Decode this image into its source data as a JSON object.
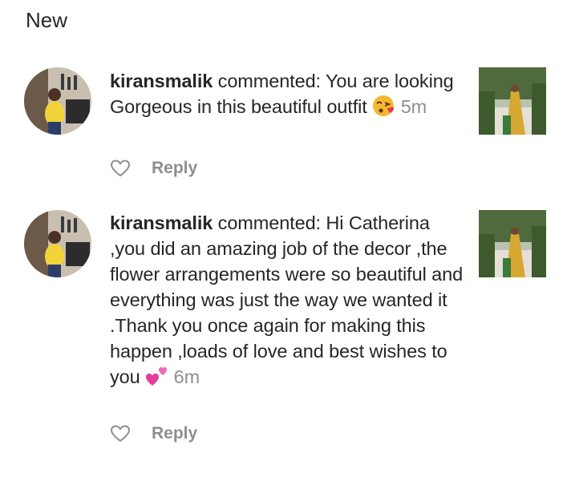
{
  "section": {
    "title": "New"
  },
  "notifications": [
    {
      "username": "kiransmalik",
      "action": " commented: ",
      "message": "You are looking Gorgeous in this beautiful outfit",
      "emoji": "kissing-face-icon",
      "time": "5m",
      "reply_label": "Reply"
    },
    {
      "username": "kiransmalik",
      "action": " commented: ",
      "message": "Hi Catherina ,you did an amazing job of the decor ,the flower arrangements were so beautiful and everything was just the way we wanted it .Thank you once again for making this happen ,loads of love and best wishes to you",
      "emoji": "two-hearts-icon",
      "time": "6m",
      "reply_label": "Reply"
    }
  ],
  "colors": {
    "text": "#262626",
    "secondary": "#8e8e8e",
    "background": "#ffffff"
  }
}
